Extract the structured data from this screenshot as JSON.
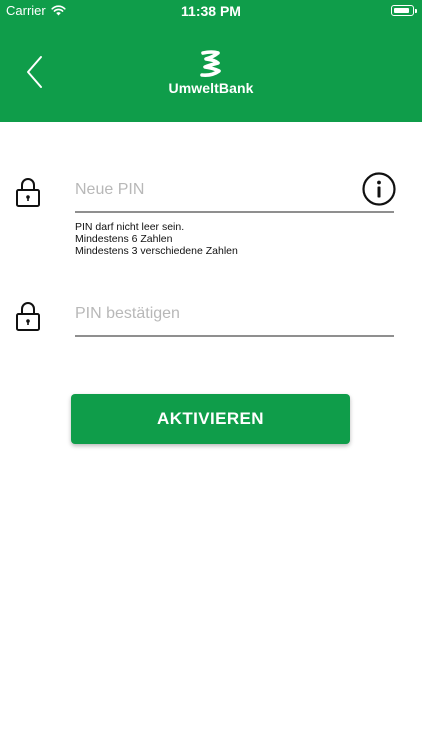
{
  "status_bar": {
    "carrier": "Carrier",
    "time": "11:38 PM",
    "wifi_icon": "wifi-icon",
    "battery_icon": "battery-icon"
  },
  "header": {
    "back_icon": "chevron-left-icon",
    "logo_text": "UmweltBank",
    "background_color": "#0f9d4a"
  },
  "new_pin": {
    "placeholder": "Neue PIN",
    "value": "",
    "lock_icon": "lock-icon",
    "info_icon": "info-icon",
    "hints": [
      "PIN darf nicht leer sein.",
      "Mindestens 6 Zahlen",
      "Mindestens 3 verschiedene Zahlen"
    ]
  },
  "confirm_pin": {
    "placeholder": "PIN bestätigen",
    "value": "",
    "lock_icon": "lock-icon"
  },
  "activate_button": {
    "label": "AKTIVIEREN",
    "color": "#0f9d4a"
  }
}
